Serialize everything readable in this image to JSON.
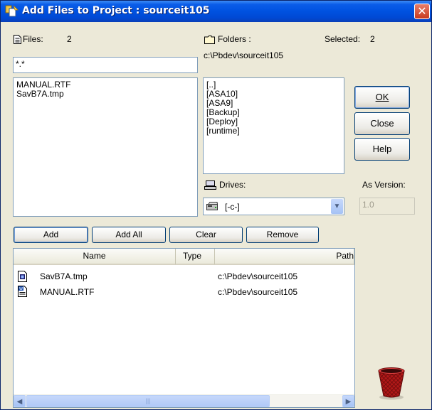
{
  "window": {
    "title": "Add Files to Project : sourceit105",
    "close_glyph": "✕"
  },
  "files": {
    "label": "Files:",
    "count": "2",
    "filter_value": "*.*",
    "items": [
      "MANUAL.RTF",
      "SavB7A.tmp"
    ]
  },
  "folders": {
    "label": "Folders :",
    "selected_label": "Selected:",
    "selected_count": "2",
    "current_path": "c:\\Pbdev\\sourceit105",
    "items": [
      "[..]",
      "[ASA10]",
      "[ASA9]",
      "[Backup]",
      "[Deploy]",
      "[runtime]"
    ]
  },
  "drives": {
    "label": "Drives:",
    "selected": "[-c-]"
  },
  "buttons": {
    "ok": "OK",
    "close": "Close",
    "help": "Help",
    "add": "Add",
    "add_all": "Add All",
    "clear": "Clear",
    "remove": "Remove"
  },
  "version": {
    "label": "As Version:",
    "value": "1.0"
  },
  "table": {
    "columns": [
      "Name",
      "Type",
      "Path"
    ],
    "rows": [
      {
        "name": "SavB7A.tmp",
        "type": "",
        "path": "c:\\Pbdev\\sourceit105",
        "icon": "tmp-file-icon"
      },
      {
        "name": "MANUAL.RTF",
        "type": "",
        "path": "c:\\Pbdev\\sourceit105",
        "icon": "rtf-document-icon"
      }
    ]
  },
  "colors": {
    "title_bar": "#0054e3",
    "dialog_bg": "#ece9d8",
    "button_border": "#003c74",
    "close_button": "#c83a1e"
  }
}
